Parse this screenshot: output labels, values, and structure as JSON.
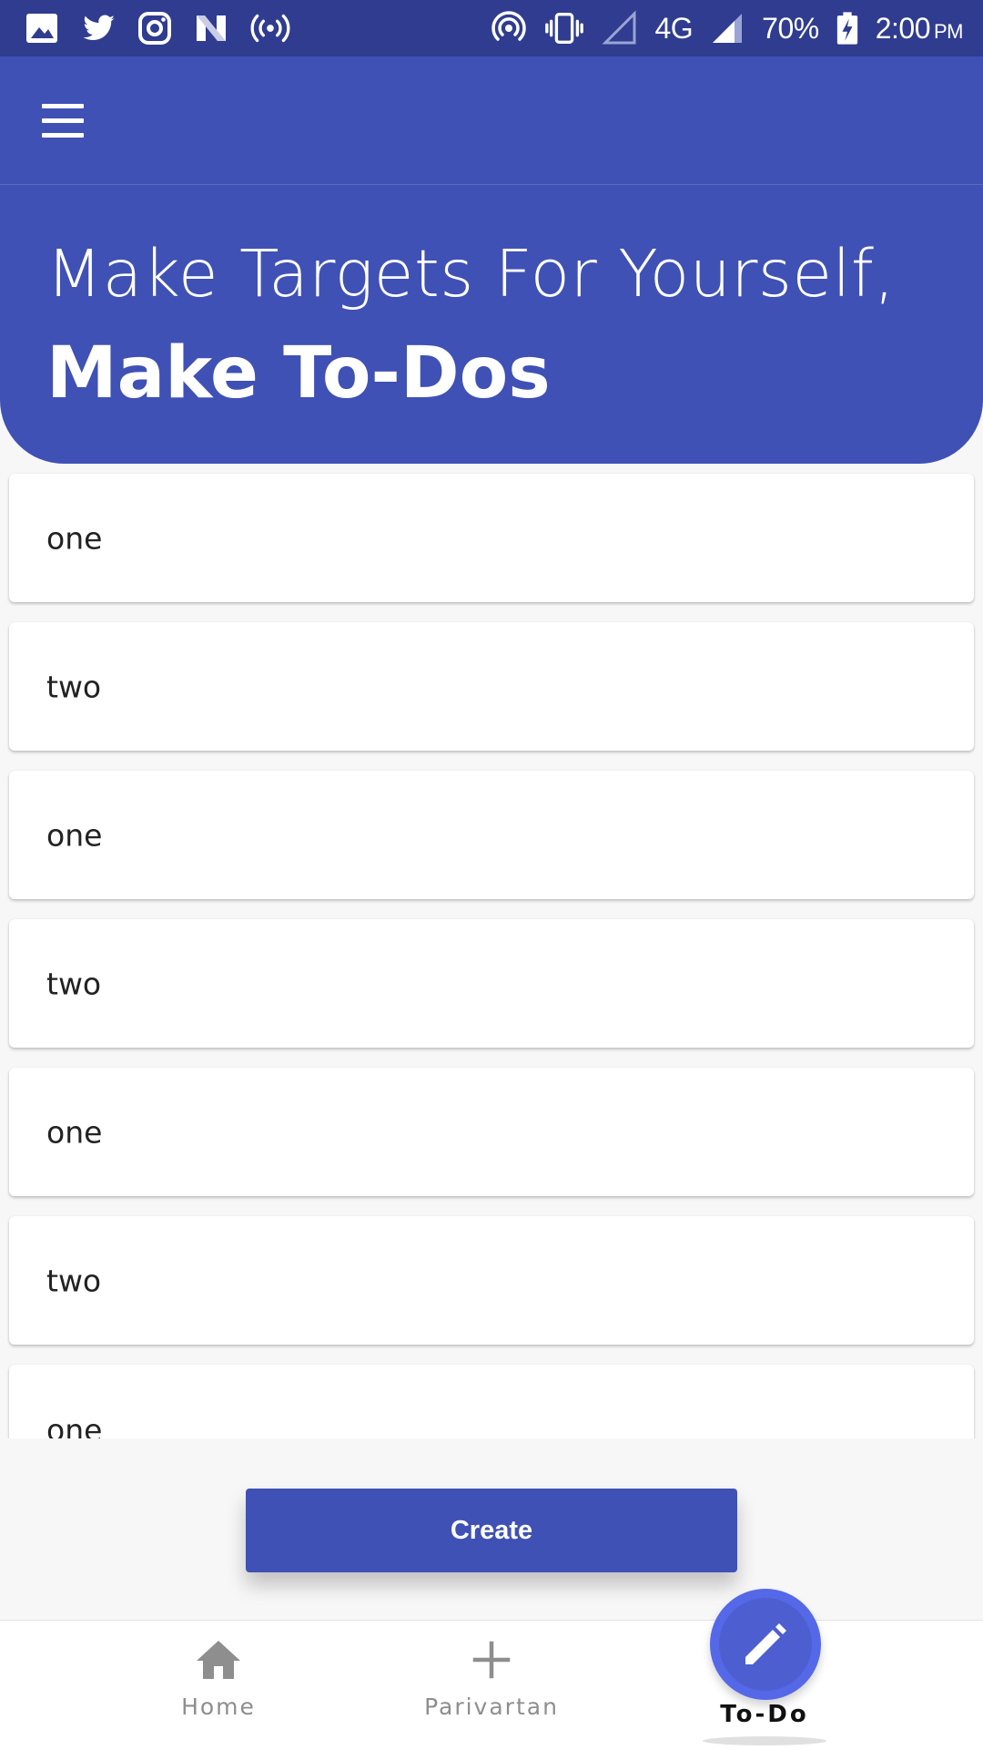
{
  "status_bar": {
    "network": "4G",
    "battery": "70%",
    "time": "2:00",
    "ampm": "PM",
    "left_icons": [
      "gallery-icon",
      "twitter-icon",
      "instagram-icon",
      "n-icon",
      "broadcast-icon"
    ],
    "right_icons": [
      "hotspot-icon",
      "vibrate-icon",
      "signal-empty-icon",
      "signal-icon",
      "battery-charging-icon"
    ]
  },
  "app_bar": {
    "menu_icon": "hamburger-menu-icon"
  },
  "header": {
    "line1": "Make Targets For Yourself,",
    "line2": "Make To-Dos"
  },
  "todos": [
    {
      "label": "one"
    },
    {
      "label": "two"
    },
    {
      "label": "one"
    },
    {
      "label": "two"
    },
    {
      "label": "one"
    },
    {
      "label": "two"
    },
    {
      "label": "one"
    }
  ],
  "create_button": {
    "label": "Create"
  },
  "bottom_nav": {
    "items": [
      {
        "label": "Home",
        "icon": "home-icon"
      },
      {
        "label": "Parivartan",
        "icon": "plus-icon"
      },
      {
        "label": "To-Do",
        "icon": "pencil-icon",
        "active": true
      }
    ]
  },
  "colors": {
    "primary": "#3f51b5",
    "status_bar": "#2f3c8f",
    "fab": "#4d5fd0",
    "background": "#f7f7f7"
  }
}
